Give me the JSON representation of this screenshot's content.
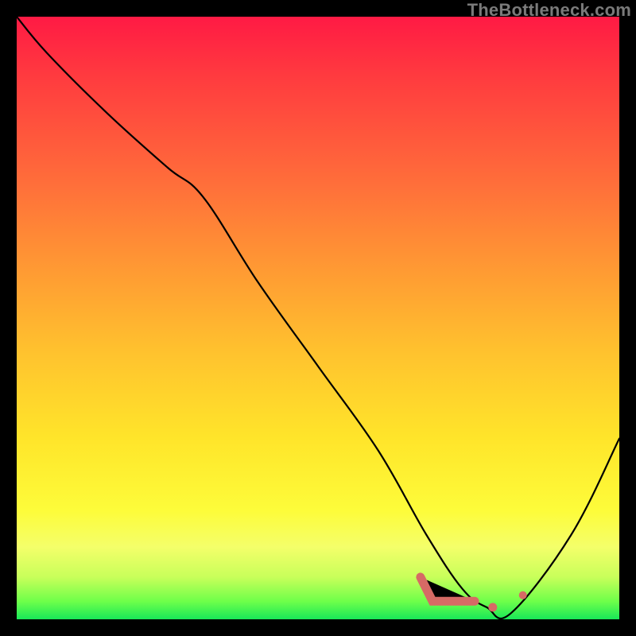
{
  "watermark": "TheBottleneck.com",
  "colors": {
    "frame_border": "#000000",
    "curve": "#000000",
    "marker": "#d66a65",
    "gradient_top": "#ff1a44",
    "gradient_bottom": "#18e858"
  },
  "chart_data": {
    "type": "line",
    "title": "",
    "xlabel": "",
    "ylabel": "",
    "ylim": [
      0,
      100
    ],
    "xlim": [
      0,
      100
    ],
    "series": [
      {
        "name": "bottleneck-curve",
        "x": [
          0,
          5,
          15,
          25,
          31,
          40,
          50,
          60,
          68,
          74,
          78,
          82,
          92,
          100
        ],
        "values": [
          100,
          94,
          84,
          75,
          70,
          56,
          42,
          28,
          14,
          5,
          2,
          1,
          14,
          30
        ]
      }
    ],
    "annotations": [
      {
        "name": "valley-dash-start",
        "x": 67,
        "y": 7
      },
      {
        "name": "valley-dash-elbow",
        "x": 69,
        "y": 3
      },
      {
        "name": "valley-dash-end",
        "x": 76,
        "y": 3
      },
      {
        "name": "valley-dot-1",
        "x": 79,
        "y": 2
      },
      {
        "name": "valley-dot-2",
        "x": 84,
        "y": 4
      }
    ]
  }
}
